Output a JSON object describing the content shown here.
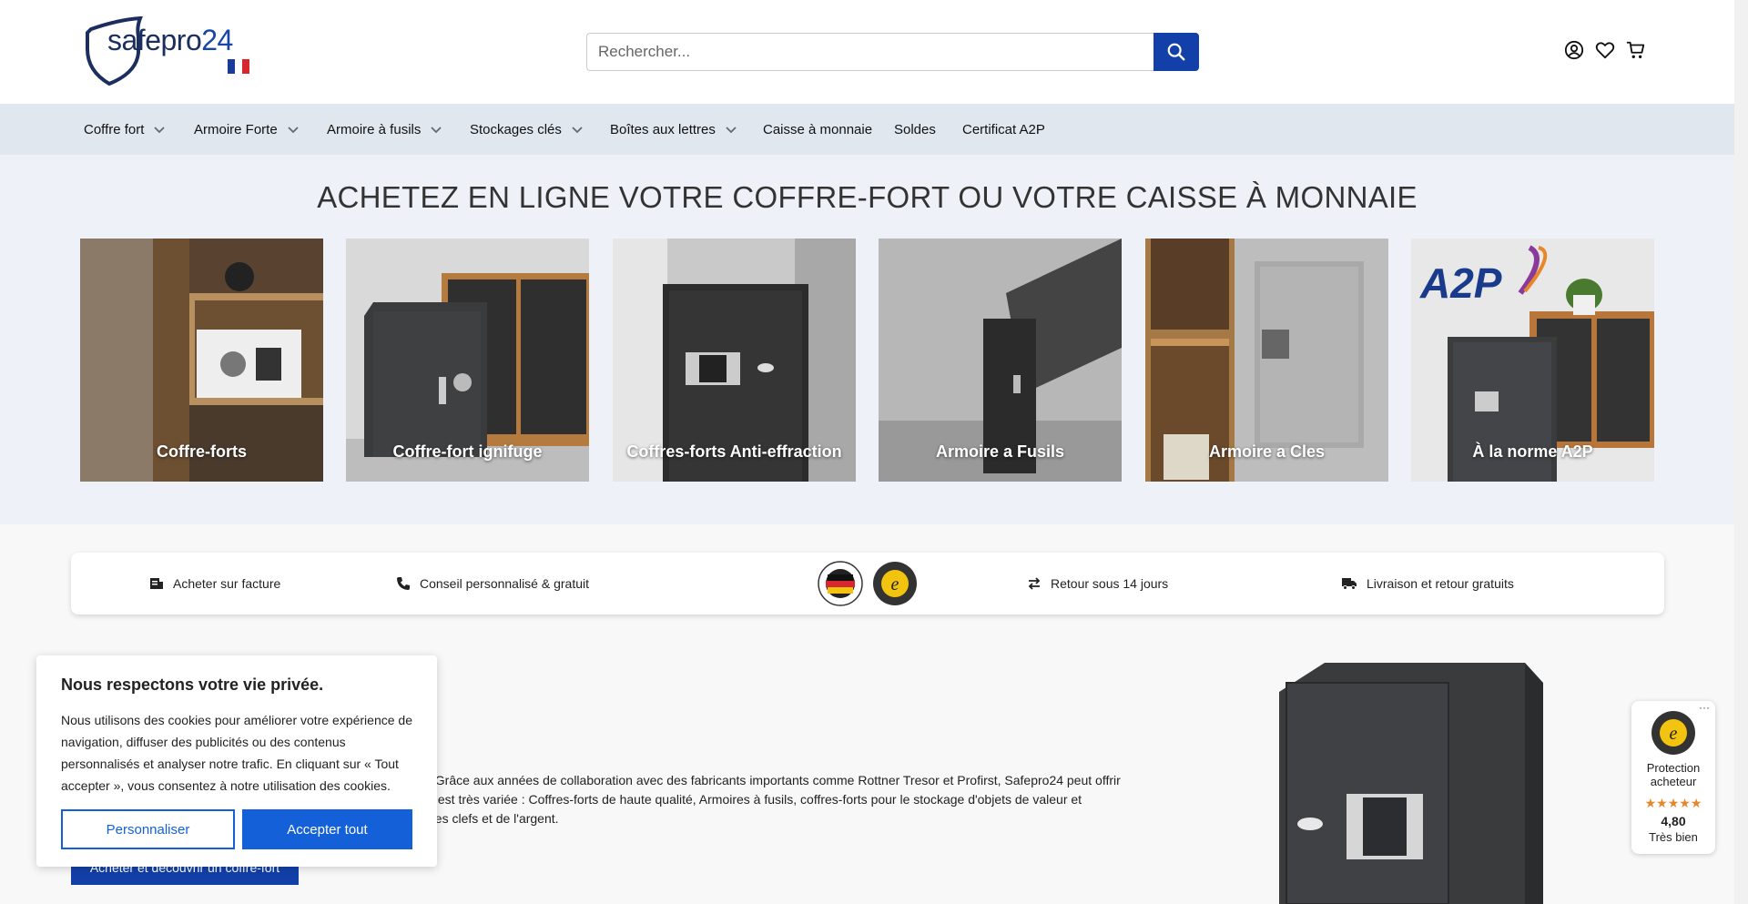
{
  "header": {
    "logo_text": "safepro",
    "logo_number": "24",
    "search_placeholder": "Rechercher...",
    "icons": [
      "search-icon",
      "account-icon",
      "wishlist-heart-icon",
      "cart-icon"
    ]
  },
  "nav": {
    "items": [
      {
        "label": "Coffre fort",
        "has_dropdown": true
      },
      {
        "label": "Armoire Forte",
        "has_dropdown": true
      },
      {
        "label": "Armoire à fusils",
        "has_dropdown": true
      },
      {
        "label": "Stockages clés",
        "has_dropdown": true
      },
      {
        "label": "Boîtes aux lettres",
        "has_dropdown": true
      },
      {
        "label": "Caisse à monnaie",
        "has_dropdown": false
      },
      {
        "label": "Soldes",
        "has_dropdown": false
      },
      {
        "label": "Certificat A2P",
        "has_dropdown": false
      }
    ]
  },
  "hero": {
    "title": "ACHETEZ EN LIGNE VOTRE COFFRE-FORT OU VOTRE CAISSE À MONNAIE",
    "categories": [
      {
        "label": "Coffre-forts"
      },
      {
        "label": "Coffre-fort ignifuge"
      },
      {
        "label": "Coffres-forts Anti-effraction"
      },
      {
        "label": "Armoire a Fusils"
      },
      {
        "label": "Armoire a Cles"
      },
      {
        "label": "À la norme A2P",
        "logo_text": "A2P"
      }
    ]
  },
  "usp": {
    "items": [
      {
        "label": "Acheter sur facture",
        "icon": "invoice-icon"
      },
      {
        "label": "Conseil personnalisé & gratuit",
        "icon": "phone-icon"
      },
      {
        "label": "Retour sous 14 jours",
        "icon": "return-arrows-icon"
      },
      {
        "label": "Livraison et retour gratuits",
        "icon": "delivery-truck-icon"
      }
    ],
    "seals": [
      "german-quality-seal-icon",
      "trusted-shops-guarantee-seal-icon"
    ]
  },
  "main": {
    "line1": ".",
    "line2": ". Grâce aux années de collaboration avec des fabricants importants comme Rottner Tresor et Profirst, Safepro24 peut offrir",
    "line3": "s est très variée : Coffres-forts de haute qualité, Armoires à fusils, coffres-forts pour le stockage d'objets de valeur et",
    "line4": "des clefs et de l'argent.",
    "cta_label": "Acheter et découvrir un coffre-fort"
  },
  "cookie": {
    "title": "Nous respectons votre vie privée.",
    "text": "Nous utilisons des cookies pour améliorer votre expérience de navigation, diffuser des publicités ou des contenus personnalisés et analyser notre trafic. En cliquant sur « Tout accepter », vous consentez à notre utilisation des cookies.",
    "customize_label": "Personnaliser",
    "accept_label": "Accepter tout"
  },
  "trust_badge": {
    "menu": "···",
    "label": "Protection acheteur",
    "stars": "★★★★★",
    "rating": 4.8,
    "score": "4,80",
    "grade": "Très bien"
  },
  "colors": {
    "brand_blue": "#1340a8",
    "cookie_blue": "#1460d8",
    "nav_bg": "#e1e7ef",
    "hero_bg": "#eef2f8",
    "star_orange": "#e8872a"
  }
}
